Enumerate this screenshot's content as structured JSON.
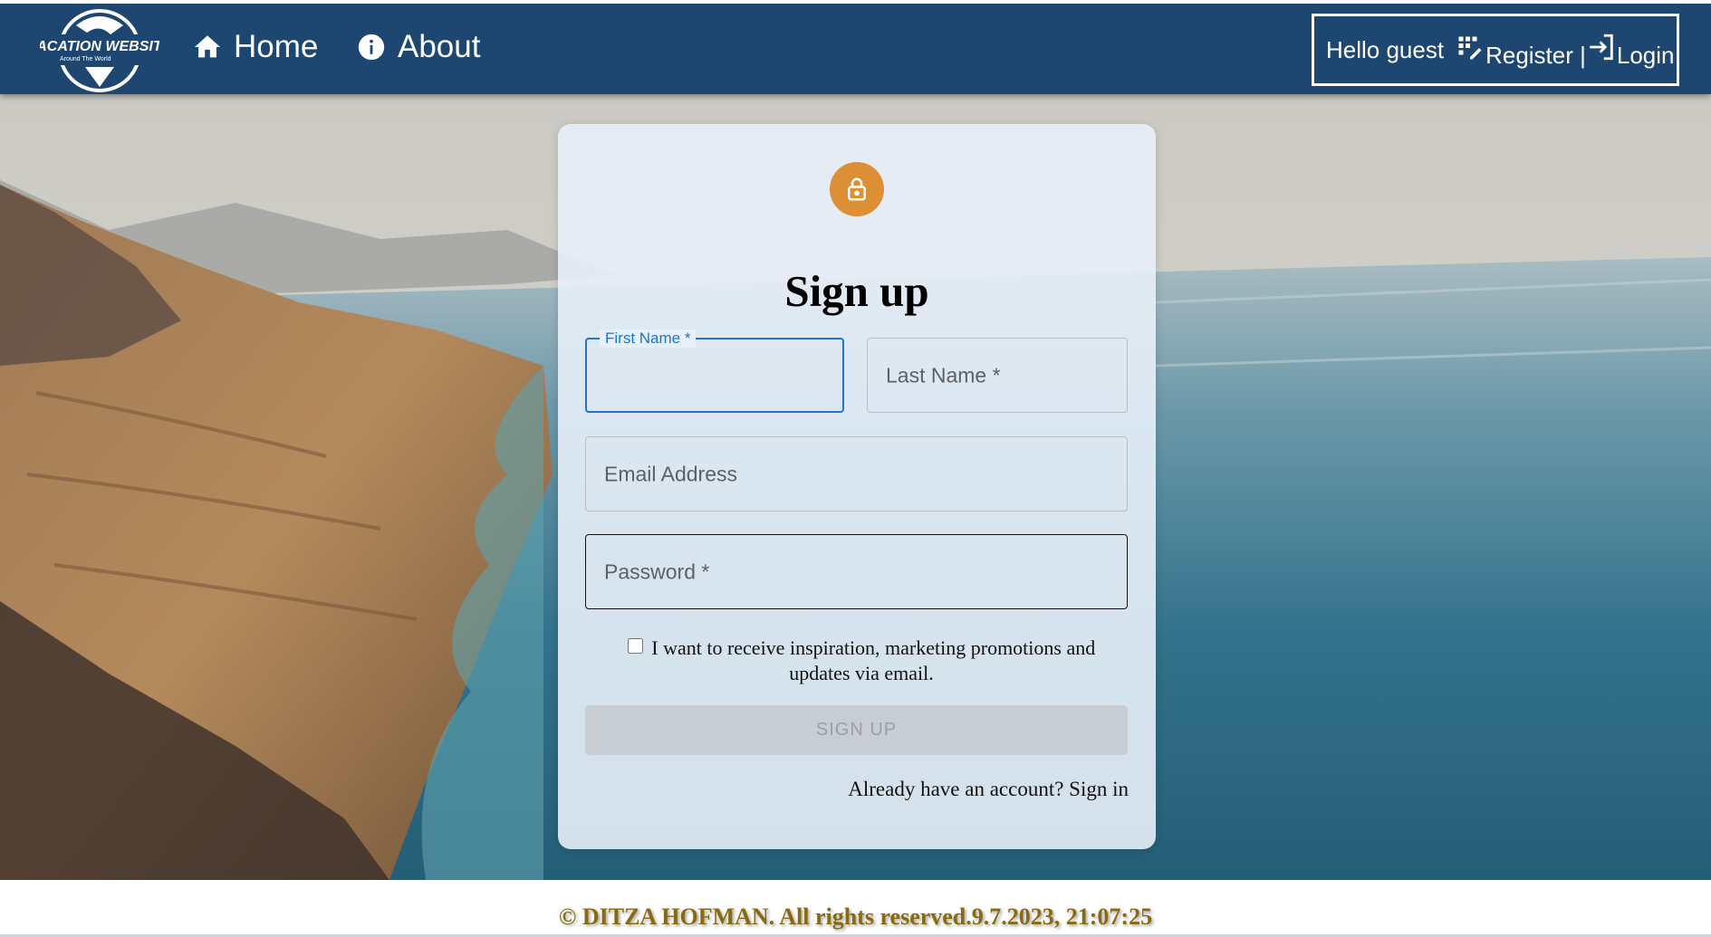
{
  "header": {
    "logo": {
      "title": "VACATION WEBSITE",
      "subtitle": "Around The World"
    },
    "nav": [
      {
        "label": "Home",
        "icon": "home-icon"
      },
      {
        "label": "About",
        "icon": "info-icon"
      }
    ],
    "user": {
      "greeting": "Hello guest",
      "register_label": "Register |",
      "login_label": "Login"
    }
  },
  "signup": {
    "title": "Sign up",
    "first_name_label": "First Name *",
    "last_name_placeholder": "Last Name *",
    "email_placeholder": "Email Address",
    "password_placeholder": "Password *",
    "marketing_opt_in": "I want to receive inspiration, marketing promotions and updates via email.",
    "marketing_checked": false,
    "submit_label": "SIGN UP",
    "signin_link": "Already have an account? Sign in"
  },
  "footer": {
    "copyright": "© DITZA HOFMAN. All rights reserved.9.7.2023, 21:07:25"
  },
  "colors": {
    "header_bg": "#1d4670",
    "lock_accent": "#dc8f34",
    "focus_blue": "#1976d2",
    "footer_text": "#8a6a10"
  }
}
